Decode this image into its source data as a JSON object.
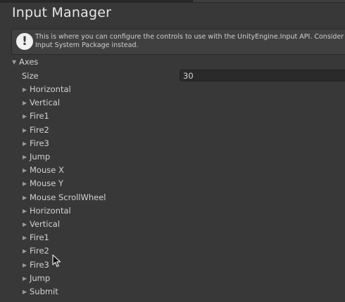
{
  "header": {
    "title": "Input Manager"
  },
  "help_box": {
    "icon": "warning-icon",
    "line1": "This is where you can configure the controls to use with the UnityEngine.Input API. Consider using the new",
    "line2": "Input System Package instead."
  },
  "axes": {
    "label": "Axes",
    "expanded": true,
    "size_label": "Size",
    "size_value": "30",
    "items": [
      "Horizontal",
      "Vertical",
      "Fire1",
      "Fire2",
      "Fire3",
      "Jump",
      "Mouse X",
      "Mouse Y",
      "Mouse ScrollWheel",
      "Horizontal",
      "Vertical",
      "Fire1",
      "Fire2",
      "Fire3",
      "Jump",
      "Submit"
    ]
  }
}
